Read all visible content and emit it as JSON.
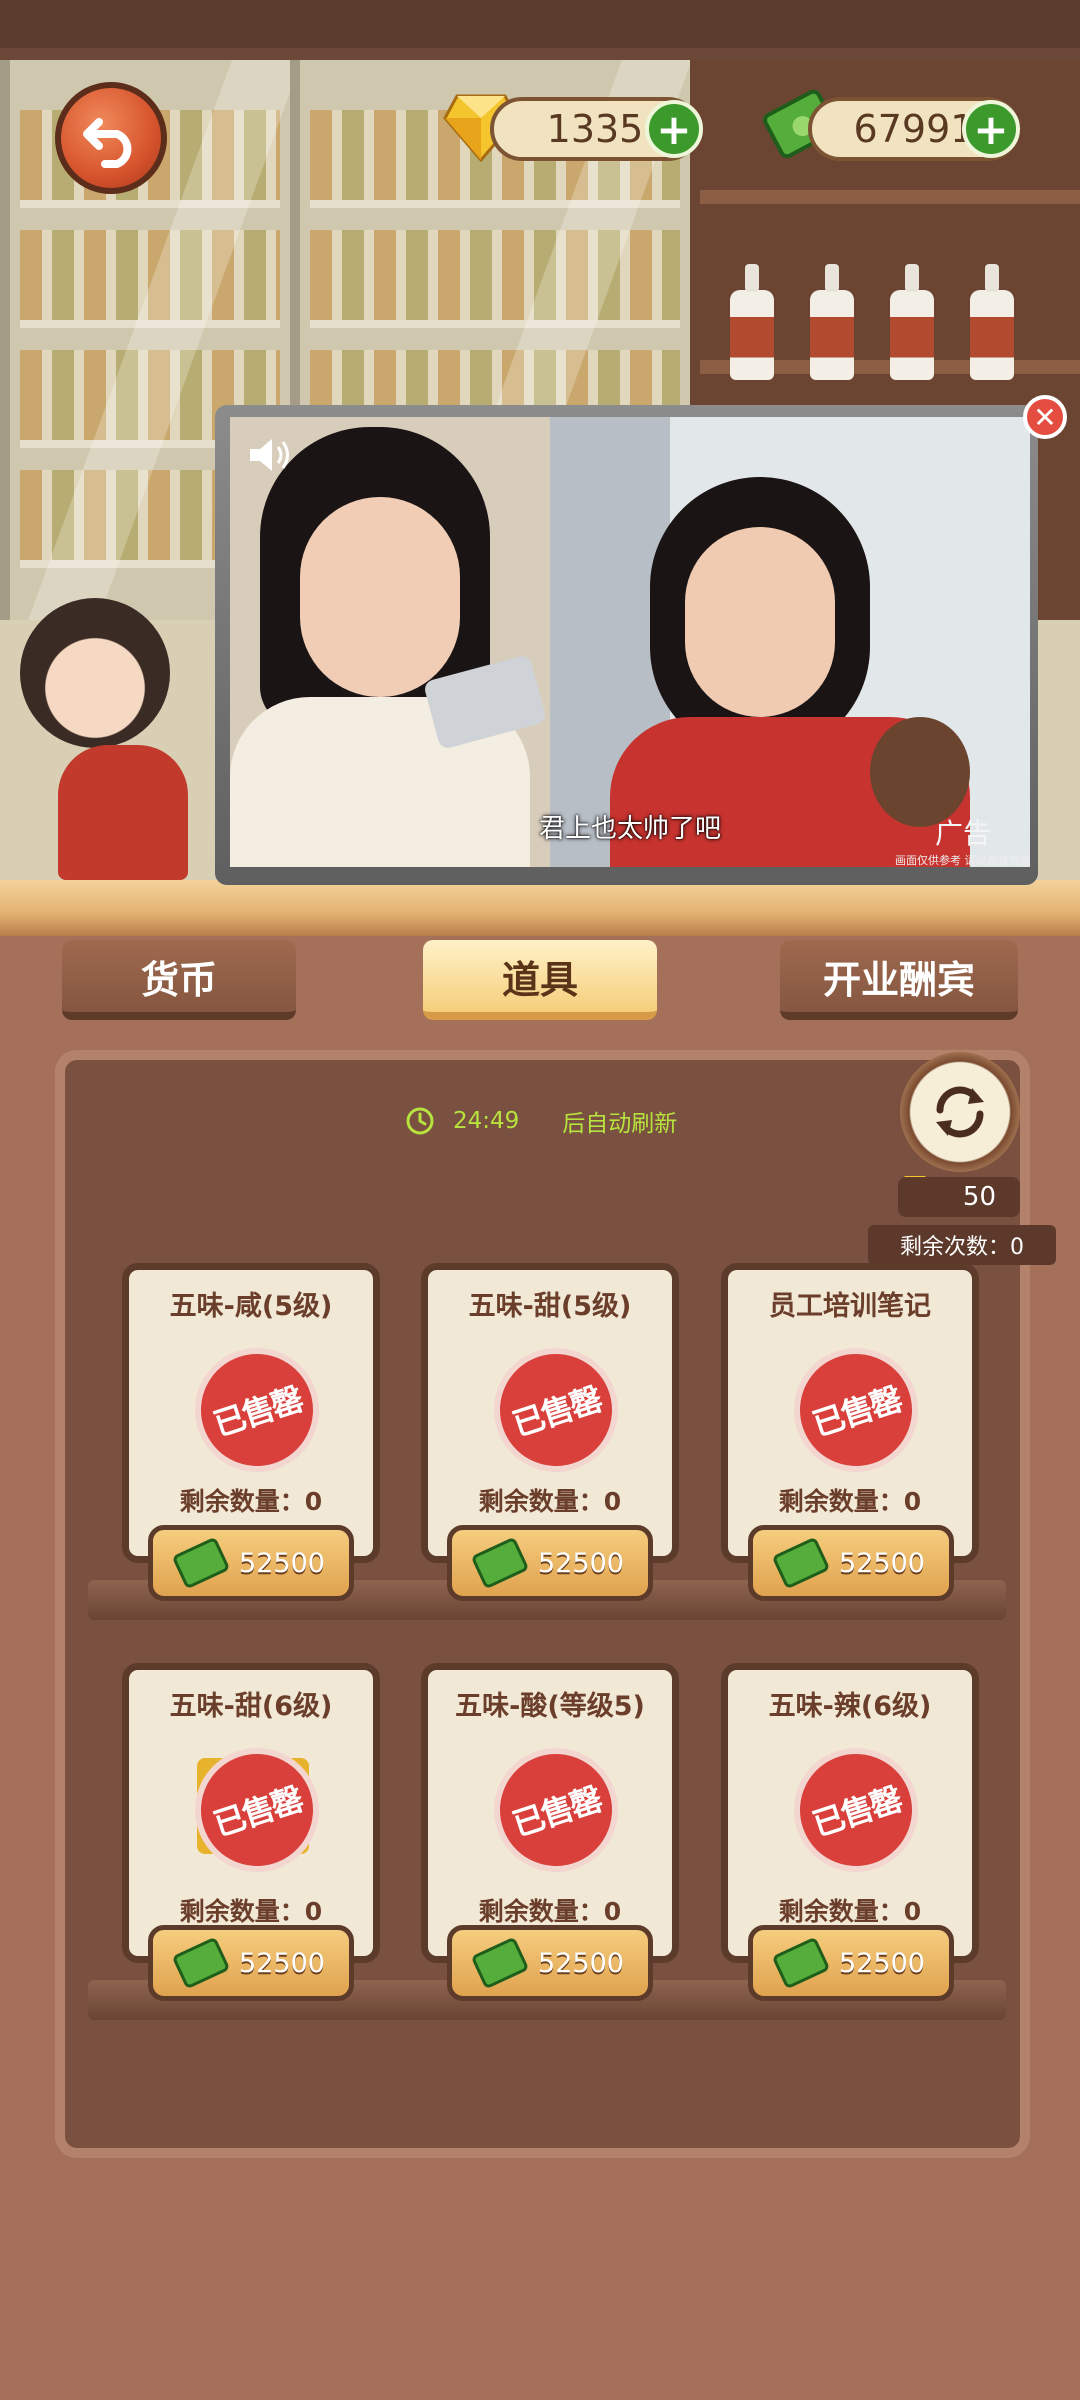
{
  "currency": {
    "gems": "1335",
    "cash": "67991"
  },
  "ad": {
    "subtitle": "君上也太帅了吧",
    "tag": "广告",
    "disclaimer": "画面仅供参考 请以游戏为准"
  },
  "tabs": [
    {
      "label": "货币",
      "active": false
    },
    {
      "label": "道具",
      "active": true
    },
    {
      "label": "开业酬宾",
      "active": false
    }
  ],
  "refresh": {
    "countdown": "24:49",
    "suffix": "后自动刷新",
    "cost": "50",
    "remaining": "剩余次数：0"
  },
  "items": [
    {
      "name": "五味-咸(5级)",
      "stamp": "已售罄",
      "remaining": "剩余数量：0",
      "price": "52500"
    },
    {
      "name": "五味-甜(5级)",
      "stamp": "已售罄",
      "remaining": "剩余数量：0",
      "price": "52500"
    },
    {
      "name": "员工培训笔记",
      "stamp": "已售罄",
      "remaining": "剩余数量：0",
      "price": "52500"
    },
    {
      "name": "五味-甜(6级)",
      "stamp": "已售罄",
      "remaining": "剩余数量：0",
      "price": "52500"
    },
    {
      "name": "五味-酸(等级5)",
      "stamp": "已售罄",
      "remaining": "剩余数量：0",
      "price": "52500"
    },
    {
      "name": "五味-辣(6级)",
      "stamp": "已售罄",
      "remaining": "剩余数量：0",
      "price": "52500"
    }
  ]
}
